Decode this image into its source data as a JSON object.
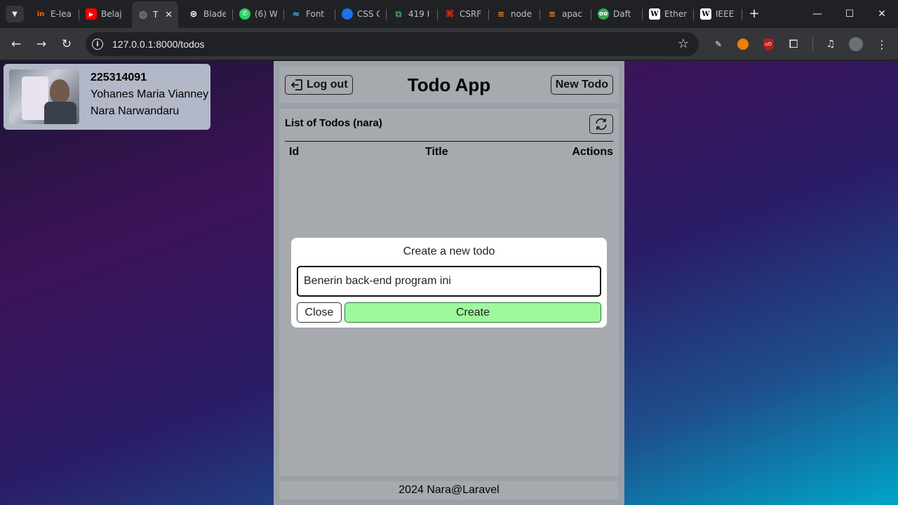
{
  "browser": {
    "tabs": [
      {
        "label": "E-lea",
        "icon": "in-logo-icon",
        "color": "#ff6a00"
      },
      {
        "label": "Belaj",
        "icon": "youtube-icon",
        "color": "#ff0000"
      },
      {
        "label": "T",
        "icon": "globe-icon",
        "color": "#9aa0a6",
        "active": true
      },
      {
        "label": "Blade",
        "icon": "openai-icon",
        "color": "#ffffff"
      },
      {
        "label": "(6) W",
        "icon": "whatsapp-icon",
        "color": "#25d366"
      },
      {
        "label": "Font",
        "icon": "tailwind-icon",
        "color": "#38bdf8"
      },
      {
        "label": "CSS G",
        "icon": "css-icon",
        "color": "#1a73e8"
      },
      {
        "label": "419 I",
        "icon": "status-icon",
        "color": "#34a853"
      },
      {
        "label": "CSRF",
        "icon": "laravel-icon",
        "color": "#ff2d20"
      },
      {
        "label": "node",
        "icon": "stackoverflow-icon",
        "color": "#f48024"
      },
      {
        "label": "apac",
        "icon": "stackoverflow-icon",
        "color": "#f48024"
      },
      {
        "label": "Daft",
        "icon": "owl-icon",
        "color": "#34a853"
      },
      {
        "label": "Ether",
        "icon": "wikipedia-icon",
        "color": "#ffffff"
      },
      {
        "label": "IEEE",
        "icon": "wikipedia-icon",
        "color": "#ffffff"
      }
    ],
    "url": "127.0.0.1:8000/todos"
  },
  "profile": {
    "id": "225314091",
    "name_line1": "Yohanes Maria Vianney",
    "name_line2": "Nara Narwandaru"
  },
  "header": {
    "logout_label": "Log out",
    "title": "Todo App",
    "new_todo_label": "New Todo"
  },
  "list": {
    "title": "List of Todos (nara)",
    "columns": [
      "Id",
      "Title",
      "Actions"
    ]
  },
  "modal": {
    "title": "Create a new todo",
    "input_value": "Benerin back-end program ini",
    "close_label": "Close",
    "create_label": "Create"
  },
  "footer": {
    "text": "2024 Nara@Laravel"
  }
}
